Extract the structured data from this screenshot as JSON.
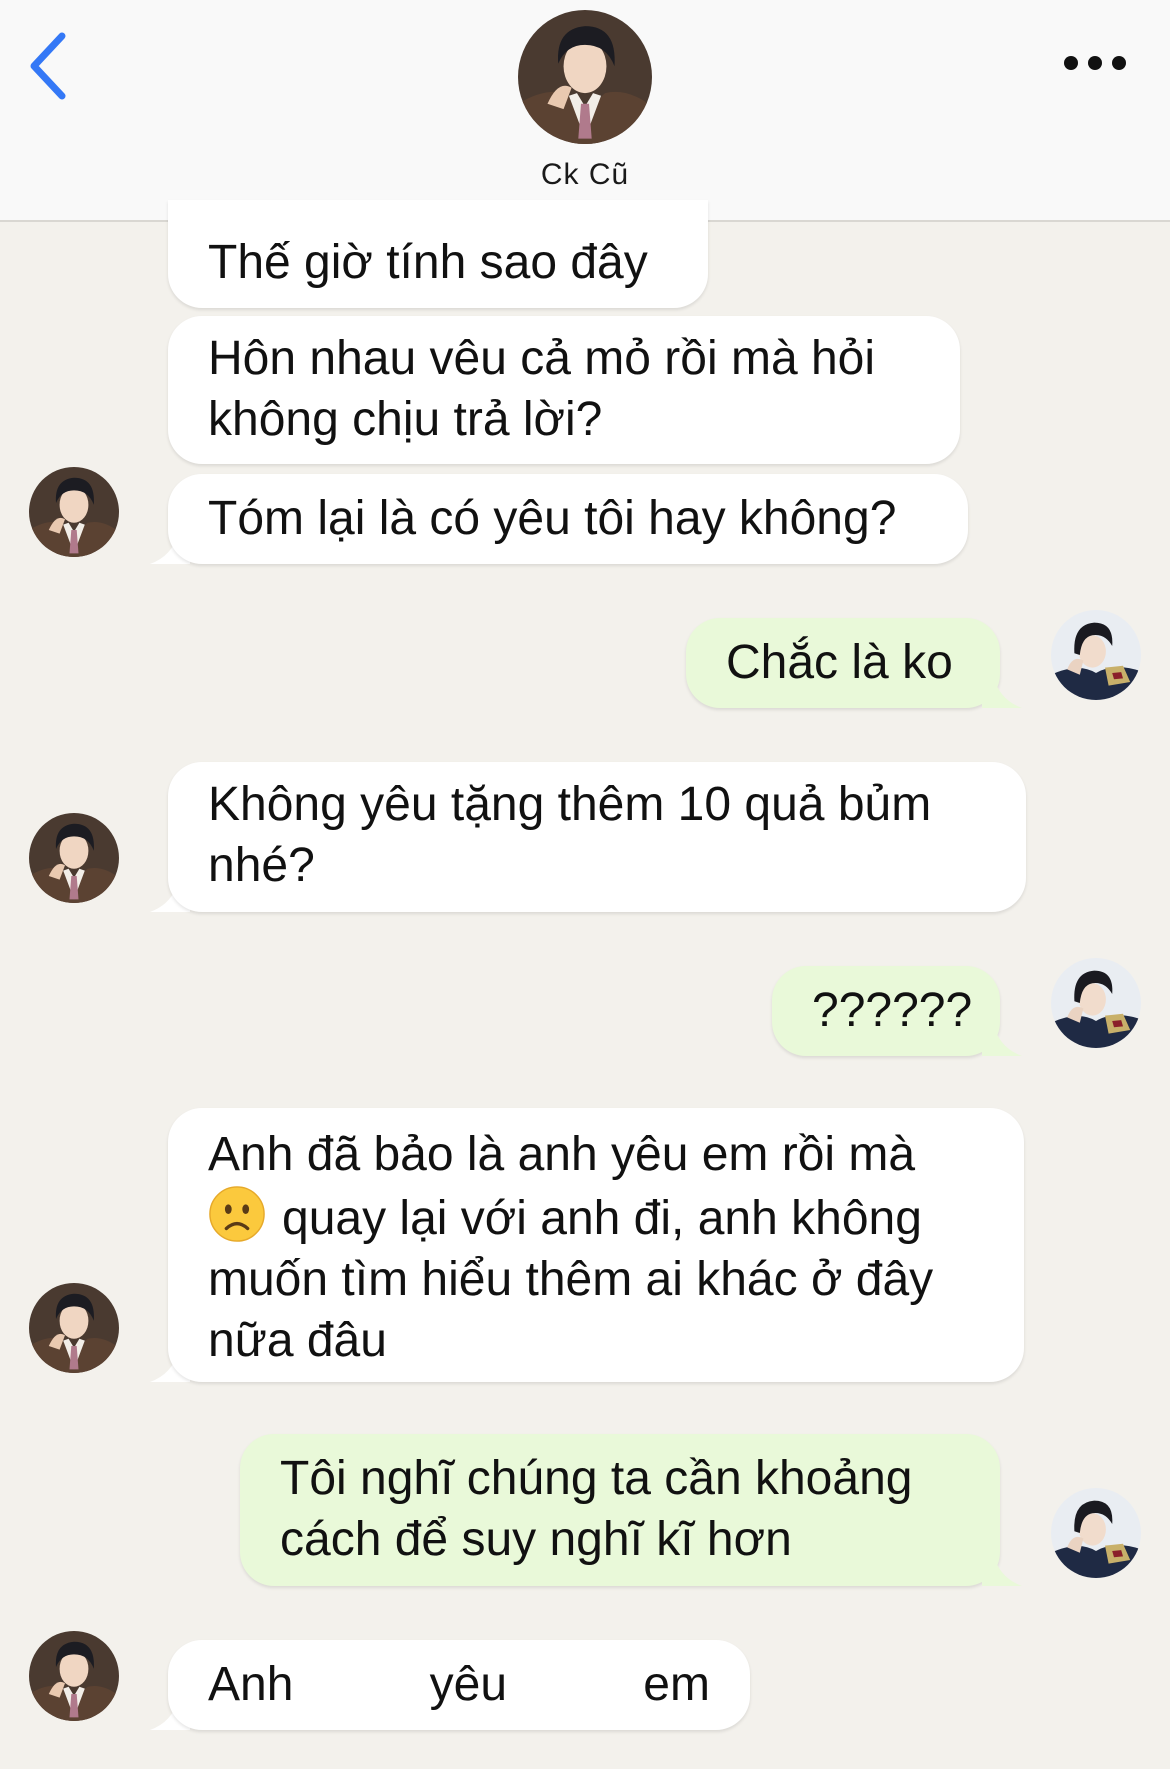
{
  "header": {
    "contact_name": "Ck Cũ",
    "back_icon": "chevron-left-icon",
    "more_icon": "ellipsis-icon",
    "accent_color": "#3478f6"
  },
  "colors": {
    "background": "#f3f1ec",
    "incoming_bubble": "#ffffff",
    "outgoing_bubble": "#e9f9d9"
  },
  "messages": [
    {
      "sender": "contact",
      "text": "Thế giờ tính sao đây"
    },
    {
      "sender": "contact",
      "text": "Hôn nhau vêu cả mỏ rồi mà hỏi không chịu trả lời?"
    },
    {
      "sender": "contact",
      "text": "Tóm lại là có yêu tôi hay không?"
    },
    {
      "sender": "me",
      "text": "Chắc là ko"
    },
    {
      "sender": "contact",
      "text": "Không yêu tặng thêm 10 quả bủm nhé?"
    },
    {
      "sender": "me",
      "text": "??????"
    },
    {
      "sender": "contact",
      "text_before_emoji": "Anh đã bảo là anh yêu em rồi mà",
      "emoji": "frowning-face-emoji",
      "text_after_emoji": "quay lại với anh đi, anh không muốn tìm hiểu thêm ai khác ở đây nữa đâu"
    },
    {
      "sender": "me",
      "text": "Tôi nghĩ chúng ta cần khoảng cách để suy nghĩ kĩ hơn"
    },
    {
      "sender": "contact",
      "words": [
        "Anh",
        "yêu",
        "em"
      ]
    }
  ]
}
